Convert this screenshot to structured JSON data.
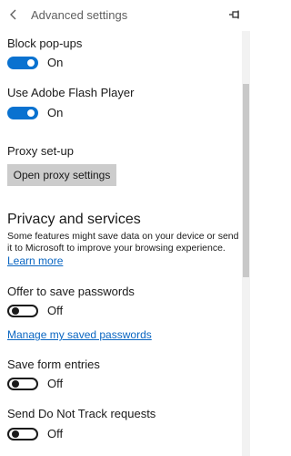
{
  "header": {
    "title": "Advanced settings",
    "back_icon": "chevron-left-icon",
    "pin_icon": "pin-icon"
  },
  "settings": {
    "block_popups": {
      "label": "Block pop-ups",
      "state": "On"
    },
    "flash": {
      "label": "Use Adobe Flash Player",
      "state": "On"
    },
    "proxy": {
      "label": "Proxy set-up",
      "button": "Open proxy settings"
    }
  },
  "privacy": {
    "heading": "Privacy and services",
    "description": "Some features might save data on your device or send it to Microsoft to improve your browsing experience.",
    "learn_more": "Learn more",
    "save_passwords": {
      "label": "Offer to save passwords",
      "state": "Off"
    },
    "manage_passwords": "Manage my saved passwords",
    "save_form": {
      "label": "Save form entries",
      "state": "Off"
    },
    "do_not_track": {
      "label": "Send Do Not Track requests",
      "state": "Off"
    }
  },
  "colors": {
    "accent": "#0a72d0",
    "link": "#0a66c2",
    "button_bg": "#cccccc"
  }
}
